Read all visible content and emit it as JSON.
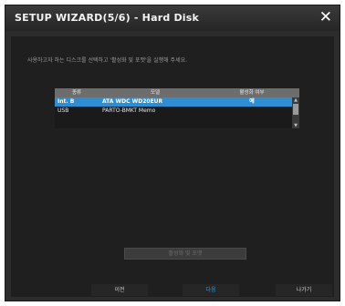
{
  "window": {
    "title": "SETUP WIZARD(5/6) - Hard Disk",
    "close_symbol": "✕",
    "close_icon": "close-icon"
  },
  "description": "사용하고자 하는 디스크를 선택하고 '활성화 및 포맷'을 실행해 주세요.",
  "disk_table": {
    "columns": [
      "종류",
      "모델",
      "활성화 여부"
    ],
    "rows": [
      {
        "type": "Int. B",
        "model": "ATA WDC WD20EUR",
        "enabled": "예",
        "selected": true
      },
      {
        "type": "USB",
        "model": "PARTO-BMKT Memo",
        "enabled": "",
        "selected": false
      }
    ],
    "scroll_up_symbol": "▲",
    "scroll_down_symbol": "▼"
  },
  "buttons": {
    "activate_format": "활성화 및 포맷",
    "prev": "이전",
    "next": "다음",
    "exit": "나가기"
  },
  "colors": {
    "accent": "#2f9be0",
    "selected_row": "#2f8ed1",
    "background": "#1f1f1f"
  }
}
